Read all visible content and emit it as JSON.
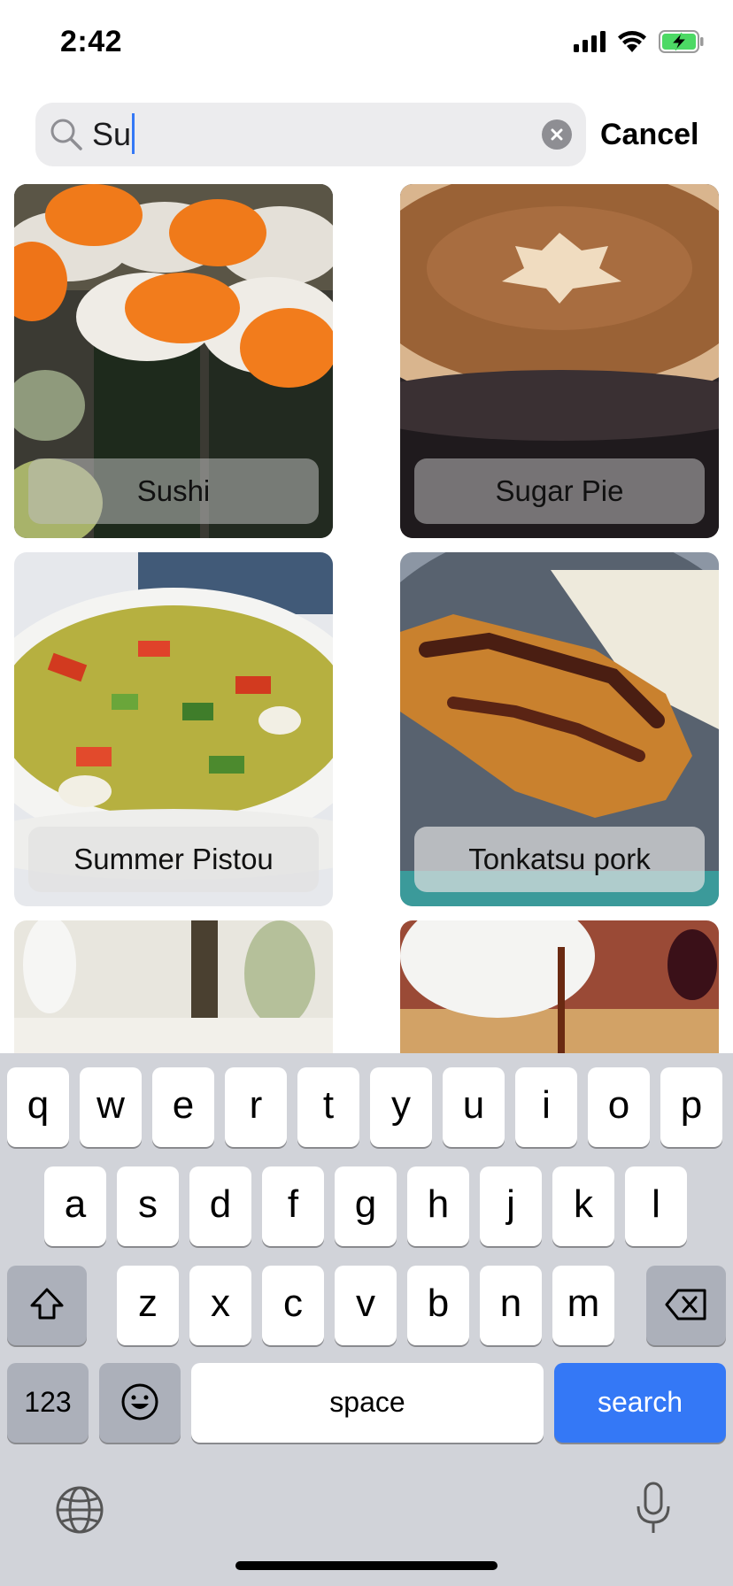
{
  "status_bar": {
    "time": "2:42",
    "icons": [
      "signal-icon",
      "wifi-icon",
      "battery-charging-icon"
    ],
    "battery_color": "#4cd964"
  },
  "search": {
    "value": "Su",
    "cancel_label": "Cancel",
    "accent_color": "#3478f6"
  },
  "results": [
    {
      "label": "Sushi"
    },
    {
      "label": "Sugar Pie"
    },
    {
      "label": "Summer Pistou"
    },
    {
      "label": "Tonkatsu pork"
    },
    {
      "label": ""
    },
    {
      "label": ""
    }
  ],
  "keyboard": {
    "row1": [
      "q",
      "w",
      "e",
      "r",
      "t",
      "y",
      "u",
      "i",
      "o",
      "p"
    ],
    "row2": [
      "a",
      "s",
      "d",
      "f",
      "g",
      "h",
      "j",
      "k",
      "l"
    ],
    "row3": [
      "z",
      "x",
      "c",
      "v",
      "b",
      "n",
      "m"
    ],
    "numbers_label": "123",
    "space_label": "space",
    "search_label": "search"
  }
}
